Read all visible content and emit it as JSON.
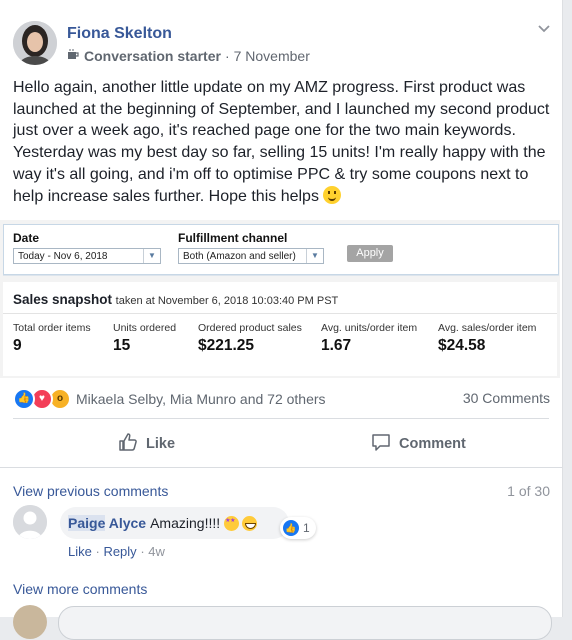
{
  "post": {
    "author": "Fiona Skelton",
    "badge": "Conversation starter",
    "separator": "·",
    "date": "7 November",
    "text": "Hello again, another little update on my AMZ progress. First product was launched at the beginning of September, and I launched my second product just over a week ago, it's reached page one for the two main keywords. Yesterday was my best day so far, selling 15 units! I'm really happy with the way it's all going, and i'm off to optimise PPC & try some coupons next to help increase sales further. Hope this helps"
  },
  "screenshot": {
    "date_label": "Date",
    "date_value": "Today - Nov 6, 2018",
    "channel_label": "Fulfillment channel",
    "channel_value": "Both (Amazon and seller)",
    "apply_label": "Apply",
    "snapshot_title": "Sales snapshot",
    "snapshot_taken": "taken at November 6, 2018 10:03:40 PM PST",
    "metrics": [
      {
        "label": "Total order items",
        "value": "9"
      },
      {
        "label": "Units ordered",
        "value": "15"
      },
      {
        "label": "Ordered product sales",
        "value": "$221.25"
      },
      {
        "label": "Avg. units/order item",
        "value": "1.67"
      },
      {
        "label": "Avg. sales/order item",
        "value": "$24.58"
      }
    ]
  },
  "reactions": {
    "names": "Mikaela Selby, Mia Munro and 72 others",
    "comments_count": "30 Comments"
  },
  "actions": {
    "like": "Like",
    "comment": "Comment"
  },
  "comments": {
    "view_previous": "View previous comments",
    "pager": "1 of 30",
    "first_name": "Paige",
    "last_name": "Alyce",
    "text": "Amazing!!!!",
    "like_count": "1",
    "like_action": "Like",
    "reply_action": "Reply",
    "age": "4w",
    "view_more": "View more comments"
  },
  "colors": {
    "link": "#385898",
    "like_blue": "#1877f2",
    "love_red": "#f33e58",
    "wow_yellow": "#f7b125"
  }
}
